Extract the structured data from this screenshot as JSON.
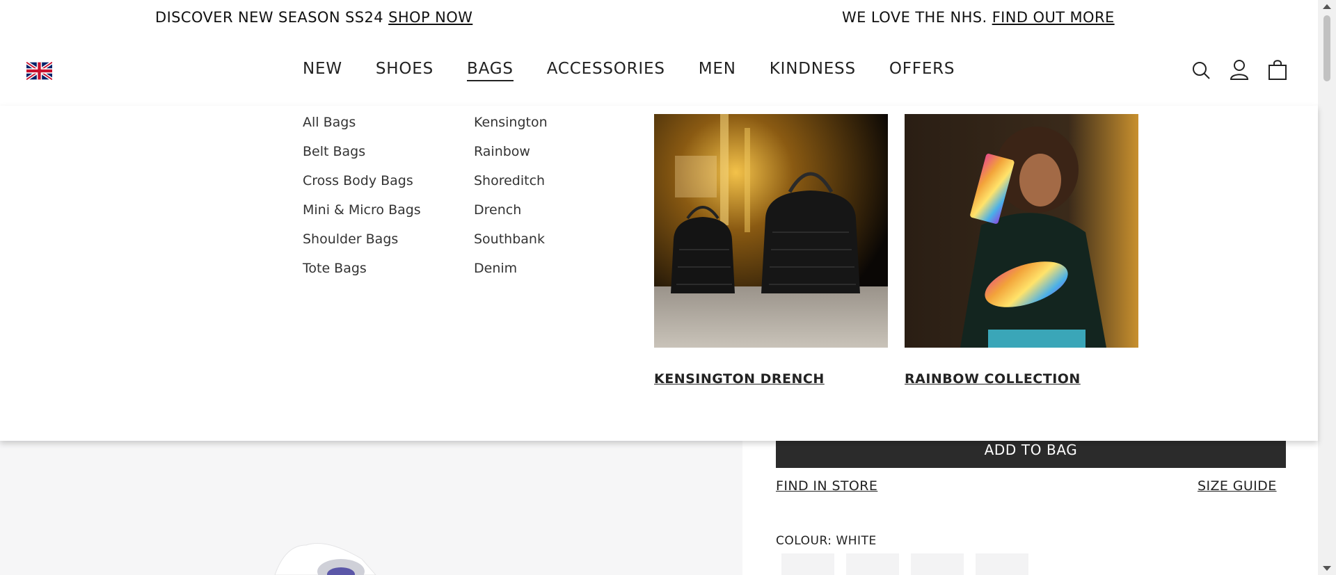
{
  "promo_bar": {
    "left_text": "DISCOVER NEW SEASON SS24",
    "left_link": "SHOP NOW",
    "right_text": "WE LOVE THE NHS.",
    "right_link": "FIND OUT MORE"
  },
  "header": {
    "flag_icon": "uk-flag-icon",
    "nav": [
      "NEW",
      "SHOES",
      "BAGS",
      "ACCESSORIES",
      "MEN",
      "KINDNESS",
      "OFFERS"
    ],
    "active_nav": "BAGS",
    "icons": [
      "search-icon",
      "account-icon",
      "shopping-bag-icon"
    ]
  },
  "mega_menu": {
    "categories": [
      "All Bags",
      "Belt Bags",
      "Cross Body Bags",
      "Mini & Micro Bags",
      "Shoulder Bags",
      "Tote Bags"
    ],
    "collections": [
      "Kensington",
      "Rainbow",
      "Shoreditch",
      "Drench",
      "Southbank",
      "Denim"
    ],
    "promos": [
      {
        "caption": "KENSINGTON DRENCH"
      },
      {
        "caption": "RAINBOW COLLECTION"
      }
    ]
  },
  "product_panel": {
    "add_to_bag": "ADD TO BAG",
    "find_in_store": "FIND IN STORE",
    "size_guide": "SIZE GUIDE",
    "colour_label": "COLOUR:",
    "colour_value": "WHITE"
  },
  "colors": {
    "button_bg": "#2b2b2b",
    "gallery_bg": "#f6f6f7"
  }
}
